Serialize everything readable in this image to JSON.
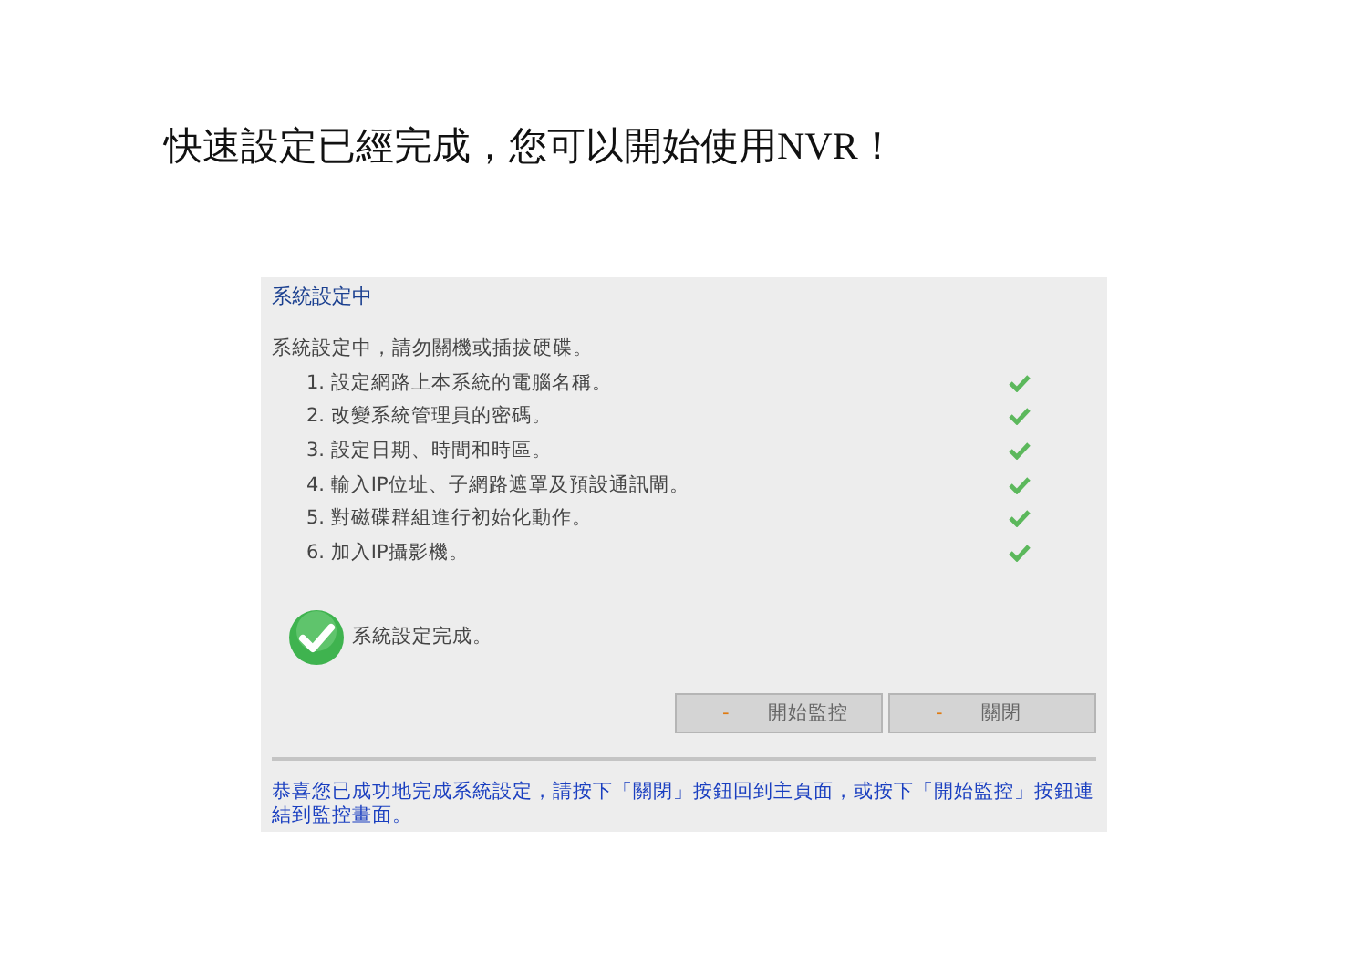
{
  "heading": "快速設定已經完成，您可以開始使用NVR！",
  "panel": {
    "title": "系統設定中",
    "intro": "系統設定中，請勿關機或插拔硬碟。",
    "steps": [
      {
        "label": "1. 設定網路上本系統的電腦名稱。",
        "done": true
      },
      {
        "label": "2. 改變系統管理員的密碼。",
        "done": true
      },
      {
        "label": "3. 設定日期、時間和時區。",
        "done": true
      },
      {
        "label": "4. 輸入IP位址、子網路遮罩及預設通訊閘。",
        "done": true
      },
      {
        "label": "5. 對磁碟群組進行初始化動作。",
        "done": true
      },
      {
        "label": "6. 加入IP攝影機。",
        "done": true
      }
    ],
    "status": "系統設定完成。",
    "buttons": [
      {
        "dash": "-",
        "label": "開始監控"
      },
      {
        "dash": "-",
        "label": "關閉"
      }
    ],
    "footer": "恭喜您已成功地完成系統設定，請按下「關閉」按鈕回到主頁面，或按下「開始監控」按鈕連結到監控畫面。"
  }
}
